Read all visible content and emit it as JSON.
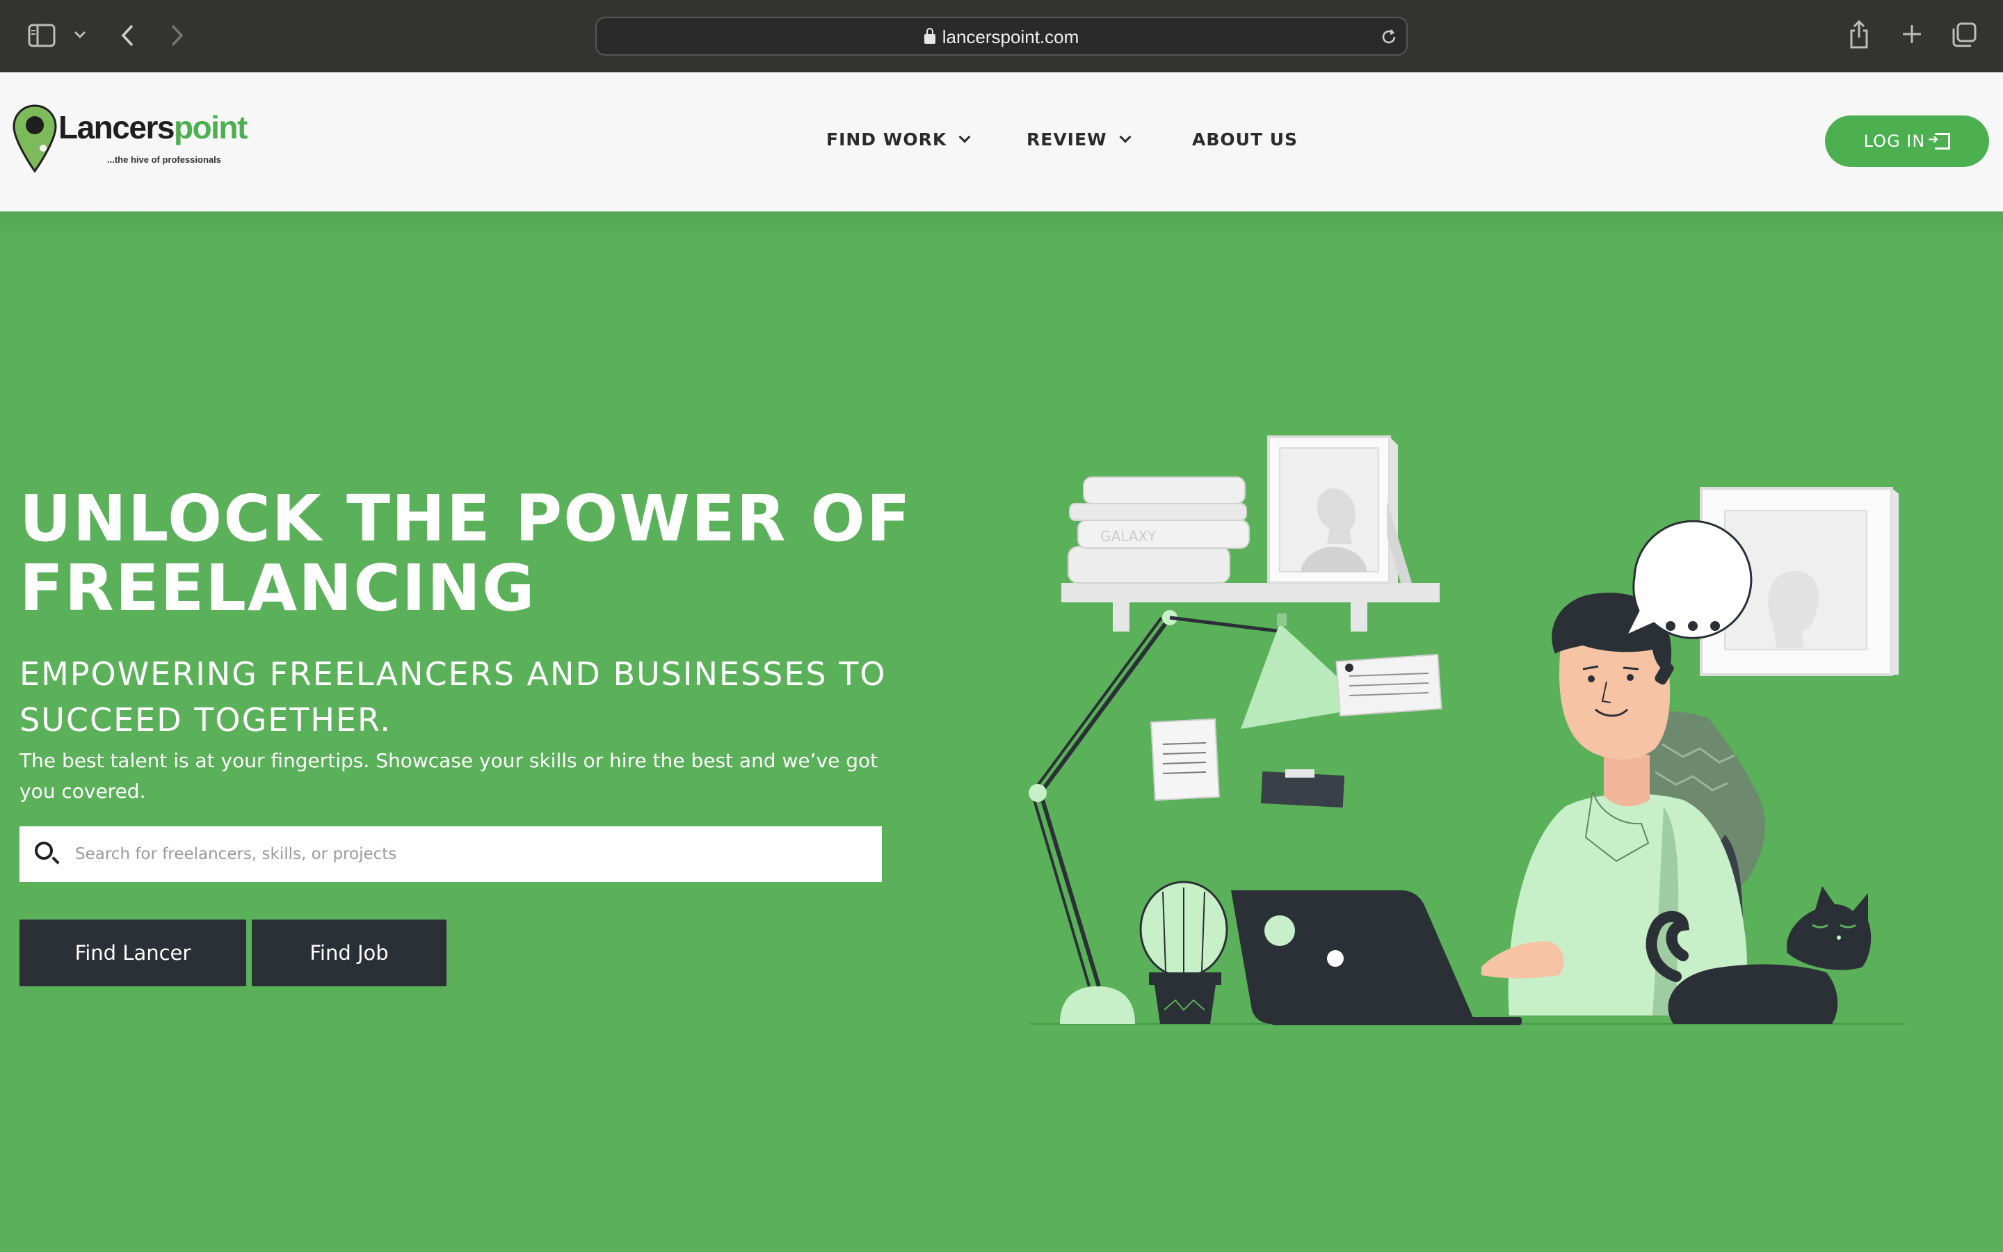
{
  "browser": {
    "url": "lancerspoint.com"
  },
  "header": {
    "logo": {
      "brand_dark": "Lancers",
      "brand_green": "point",
      "tagline": "...the hive of professionals"
    },
    "nav": [
      {
        "label": "FIND WORK",
        "has_dropdown": true
      },
      {
        "label": "REVIEW",
        "has_dropdown": true
      },
      {
        "label": "ABOUT US",
        "has_dropdown": false
      }
    ],
    "login_label": "LOG IN"
  },
  "hero": {
    "title": "UNLOCK THE POWER OF FREELANCING",
    "subtitle": "EMPOWERING FREELANCERS AND BUSINESSES TO SUCCEED TOGETHER.",
    "description": "The best talent is at your fingertips. Showcase your skills or hire the best and we’ve got you covered.",
    "search_placeholder": "Search for freelancers, skills, or projects",
    "buttons": {
      "find_lancer": "Find Lancer",
      "find_job": "Find Job"
    }
  },
  "illustration": {
    "book_label": "GALAXY"
  },
  "colors": {
    "brand_green": "#4caf50",
    "hero_bg": "#5bb05a",
    "dark_button": "#2b2f36",
    "chrome": "#333332"
  }
}
